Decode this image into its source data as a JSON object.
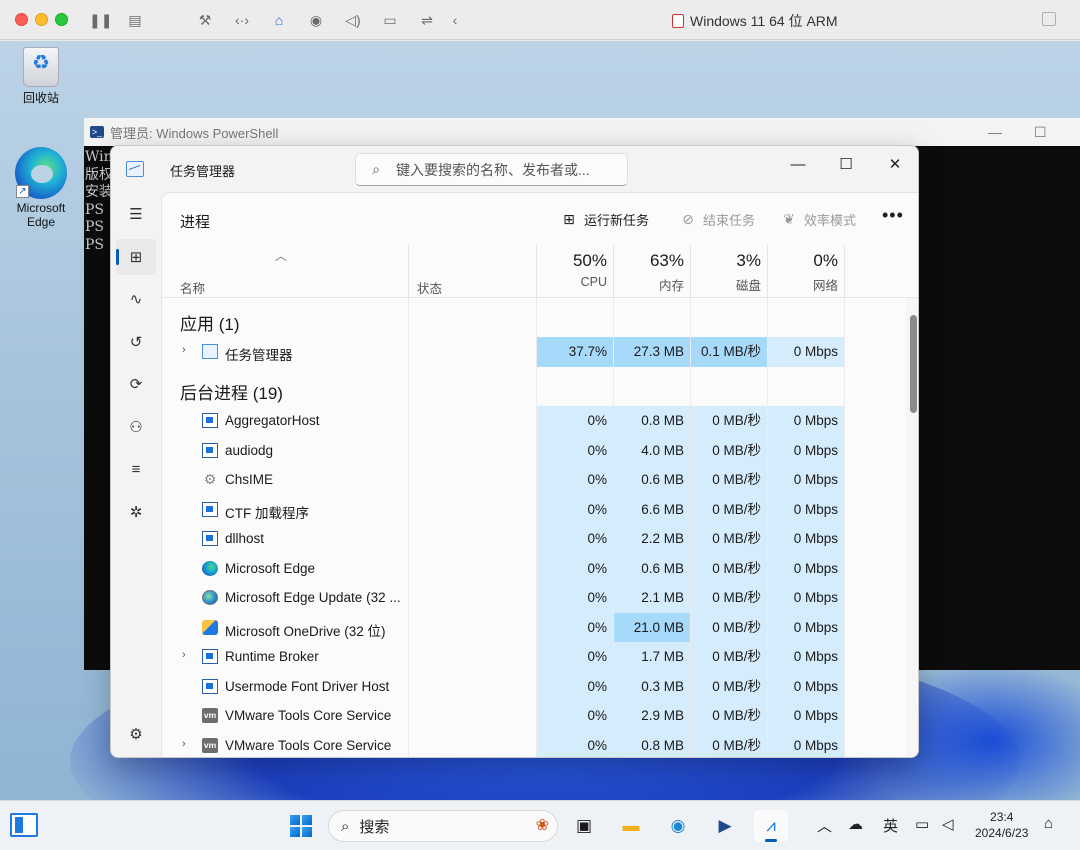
{
  "host": {
    "window_title": "Windows 11 64 位 ARM"
  },
  "desktop": {
    "icons": [
      {
        "label": "回收站",
        "icon": "recycle-bin-icon"
      },
      {
        "label": "Microsoft Edge",
        "icon": "edge-icon"
      }
    ]
  },
  "powershell": {
    "title": "管理员: Windows PowerShell",
    "lines": [
      "Win",
      "版权",
      "",
      "安装",
      "",
      "PS",
      "PS",
      "PS"
    ]
  },
  "taskmgr": {
    "title": "任务管理器",
    "search_placeholder": "键入要搜索的名称、发布者或...",
    "page_title": "进程",
    "commands": {
      "run_new_task": "运行新任务",
      "end_task": "结束任务",
      "efficiency_mode": "效率模式",
      "more": "..."
    },
    "headers": {
      "name": "名称",
      "status": "状态",
      "cpu_pct": "50%",
      "cpu": "CPU",
      "mem_pct": "63%",
      "mem": "内存",
      "disk_pct": "3%",
      "disk": "磁盘",
      "net_pct": "0%",
      "net": "网络"
    },
    "groups": {
      "apps": "应用 (1)",
      "background": "后台进程 (19)"
    },
    "apps": [
      {
        "name": "任务管理器",
        "icon": "task-manager-icon",
        "expandable": true,
        "cpu": "37.7%",
        "mem": "27.3 MB",
        "disk": "0.1 MB/秒",
        "net": "0 Mbps"
      }
    ],
    "background": [
      {
        "name": "AggregatorHost",
        "icon": "app-window-icon",
        "expandable": false,
        "cpu": "0%",
        "mem": "0.8 MB",
        "disk": "0 MB/秒",
        "net": "0 Mbps"
      },
      {
        "name": "audiodg",
        "icon": "app-window-icon",
        "expandable": false,
        "cpu": "0%",
        "mem": "4.0 MB",
        "disk": "0 MB/秒",
        "net": "0 Mbps"
      },
      {
        "name": "ChsIME",
        "icon": "gear-icon",
        "expandable": false,
        "cpu": "0%",
        "mem": "0.6 MB",
        "disk": "0 MB/秒",
        "net": "0 Mbps"
      },
      {
        "name": "CTF 加载程序",
        "icon": "app-window-icon",
        "expandable": false,
        "cpu": "0%",
        "mem": "6.6 MB",
        "disk": "0 MB/秒",
        "net": "0 Mbps"
      },
      {
        "name": "dllhost",
        "icon": "app-window-icon",
        "expandable": false,
        "cpu": "0%",
        "mem": "2.2 MB",
        "disk": "0 MB/秒",
        "net": "0 Mbps"
      },
      {
        "name": "Microsoft Edge",
        "icon": "edge-icon",
        "expandable": false,
        "cpu": "0%",
        "mem": "0.6 MB",
        "disk": "0 MB/秒",
        "net": "0 Mbps"
      },
      {
        "name": "Microsoft Edge Update (32 ...",
        "icon": "edge-update-icon",
        "expandable": false,
        "cpu": "0%",
        "mem": "2.1 MB",
        "disk": "0 MB/秒",
        "net": "0 Mbps"
      },
      {
        "name": "Microsoft OneDrive (32 位)",
        "icon": "onedrive-icon",
        "expandable": false,
        "cpu": "0%",
        "mem": "21.0 MB",
        "mem_hot": true,
        "disk": "0 MB/秒",
        "net": "0 Mbps"
      },
      {
        "name": "Runtime Broker",
        "icon": "app-window-icon",
        "expandable": true,
        "cpu": "0%",
        "mem": "1.7 MB",
        "disk": "0 MB/秒",
        "net": "0 Mbps"
      },
      {
        "name": "Usermode Font Driver Host",
        "icon": "app-window-icon",
        "expandable": false,
        "cpu": "0%",
        "mem": "0.3 MB",
        "disk": "0 MB/秒",
        "net": "0 Mbps"
      },
      {
        "name": "VMware Tools Core Service",
        "icon": "vmware-icon",
        "expandable": false,
        "cpu": "0%",
        "mem": "2.9 MB",
        "disk": "0 MB/秒",
        "net": "0 Mbps"
      },
      {
        "name": "VMware Tools Core Service",
        "icon": "vmware-icon",
        "expandable": true,
        "cpu": "0%",
        "mem": "0.8 MB",
        "disk": "0 MB/秒",
        "net": "0 Mbps"
      }
    ]
  },
  "taskbar": {
    "search_label": "搜索",
    "ime_label": "英",
    "clock_time": "23:4",
    "clock_date": "2024/6/23"
  },
  "colors": {
    "accent": "#005fb8",
    "cell_bg": "#d4ecfc",
    "cell_hot": "#a7d9fb"
  }
}
